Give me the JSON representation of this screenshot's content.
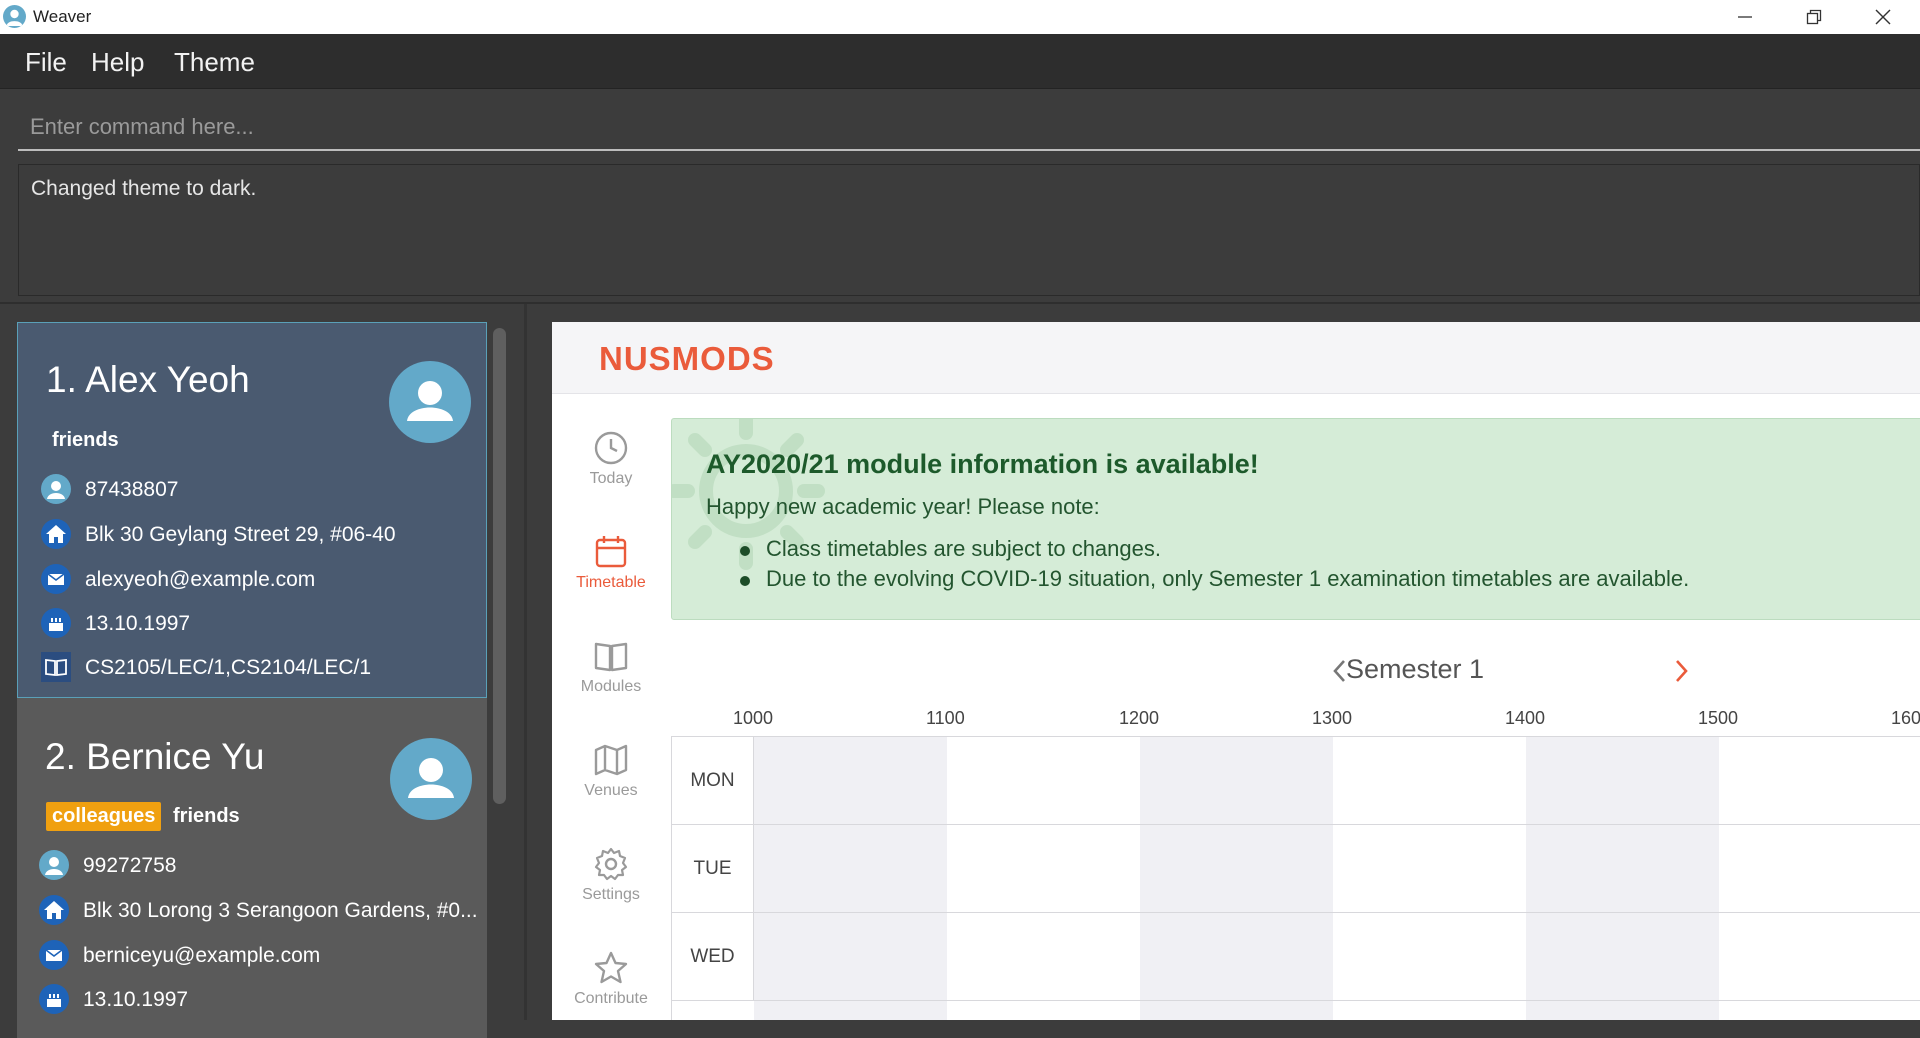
{
  "window": {
    "title": "Weaver"
  },
  "menu": {
    "items": [
      "File",
      "Help",
      "Theme"
    ]
  },
  "command": {
    "placeholder": "Enter command here..."
  },
  "result": {
    "text": "Changed theme to dark."
  },
  "persons": [
    {
      "name": "1. Alex Yeoh",
      "tags": [
        {
          "label": "friends",
          "style": "plain"
        }
      ],
      "phone": "87438807",
      "address": "Blk 30 Geylang Street 29, #06-40",
      "email": "alexyeoh@example.com",
      "birthday": "13.10.1997",
      "modules": "CS2105/LEC/1,CS2104/LEC/1"
    },
    {
      "name": "2. Bernice Yu",
      "tags": [
        {
          "label": "colleagues",
          "style": "orange"
        },
        {
          "label": "friends",
          "style": "plain"
        }
      ],
      "phone": "99272758",
      "address": "Blk 30 Lorong 3 Serangoon Gardens, #0...",
      "email": "berniceyu@example.com",
      "birthday": "13.10.1997"
    }
  ],
  "nusmods": {
    "logo": "NUSMODS",
    "accent": "#ea5b3b",
    "nav": [
      {
        "label": "Today",
        "icon": "clock-icon"
      },
      {
        "label": "Timetable",
        "icon": "calendar-icon",
        "active": true
      },
      {
        "label": "Modules",
        "icon": "book-icon"
      },
      {
        "label": "Venues",
        "icon": "map-icon"
      },
      {
        "label": "Settings",
        "icon": "gear-icon"
      },
      {
        "label": "Contribute",
        "icon": "star-icon"
      }
    ],
    "alert": {
      "title": "AY2020/21 module information is available!",
      "subtitle": "Happy new academic year! Please note:",
      "items": [
        "Class timetables are subject to changes.",
        "Due to the evolving COVID-19 situation, only Semester 1 examination timetables are available."
      ]
    },
    "semester": "Semester 1",
    "hours": [
      "1000",
      "1100",
      "1200",
      "1300",
      "1400",
      "1500",
      "160"
    ],
    "days": [
      "MON",
      "TUE",
      "WED"
    ]
  }
}
